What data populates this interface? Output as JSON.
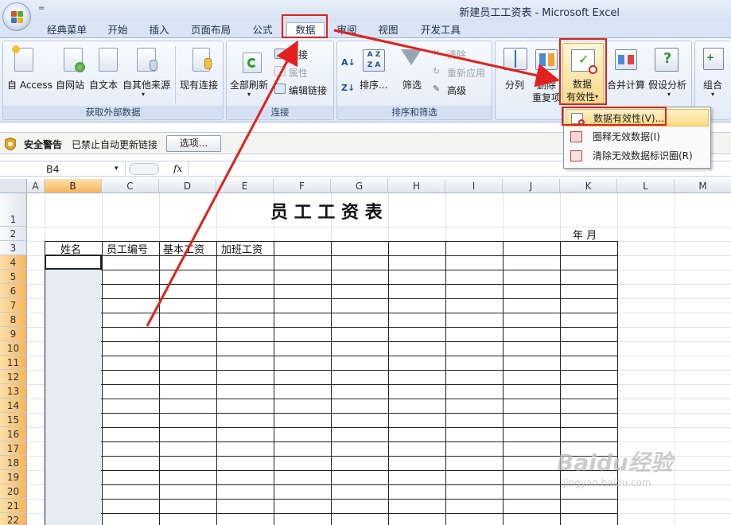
{
  "window": {
    "title": "新建员工工资表 - Microsoft Excel",
    "qat": "="
  },
  "tabs": [
    "经典菜单",
    "开始",
    "插入",
    "页面布局",
    "公式",
    "数据",
    "审阅",
    "视图",
    "开发工具"
  ],
  "active_tab": "数据",
  "ribbon": {
    "get_external": {
      "label": "获取外部数据",
      "buttons": [
        "自 Access",
        "自网站",
        "自文本",
        "自其他来源",
        "现有连接"
      ]
    },
    "connections": {
      "label": "连接",
      "refresh_all": "全部刷新",
      "items": [
        "连接",
        "属性",
        "编辑链接"
      ]
    },
    "sort_filter": {
      "label": "排序和筛选",
      "sort": "排序...",
      "filter": "筛选",
      "items": [
        "清除",
        "重新应用",
        "高级"
      ]
    },
    "data_tools": {
      "split": "分列",
      "remove_dup_1": "删除",
      "remove_dup_2": "重复项",
      "validation_1": "数据",
      "validation_2": "有效性",
      "consolidate": "合并计算",
      "what_if": "假设分析"
    },
    "outline": {
      "group": "组合"
    }
  },
  "security": {
    "title": "安全警告",
    "message": "已禁止自动更新链接",
    "options_button": "选项..."
  },
  "formula_bar": {
    "name_box": "B4",
    "fx": "fx"
  },
  "validation_menu": {
    "items": [
      "数据有效性(V)...",
      "圈释无效数据(I)",
      "清除无效数据标识圈(R)"
    ]
  },
  "sheet": {
    "columns": [
      "A",
      "B",
      "C",
      "D",
      "E",
      "F",
      "G",
      "H",
      "I",
      "J",
      "K",
      "L",
      "M"
    ],
    "rows": [
      "1",
      "2",
      "3",
      "4",
      "5",
      "6",
      "7",
      "8",
      "9",
      "10",
      "11",
      "12",
      "13",
      "14",
      "15",
      "16",
      "17",
      "18",
      "19",
      "20",
      "21",
      "22"
    ],
    "title": "员 工 工 资 表",
    "date_label": "年    月",
    "headers": [
      "姓名",
      "员工编号",
      "基本工资",
      "加班工资"
    ]
  },
  "watermark": {
    "brand": "Baidu经验",
    "url": "jingyan.baidu.com"
  },
  "colors": {
    "highlight_red": "#e3201b",
    "ribbon_bg": "#dde8f6",
    "selected_header": "#f7b45c"
  }
}
